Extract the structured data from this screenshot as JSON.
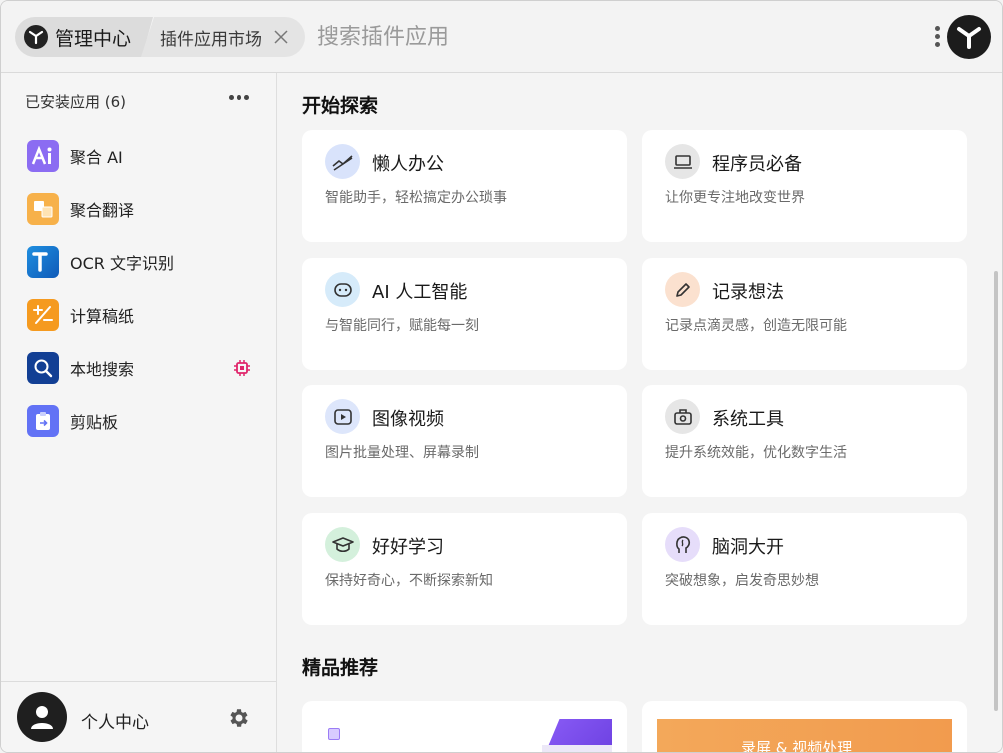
{
  "header": {
    "home_label": "管理中心",
    "market_tab_label": "插件应用市场",
    "search_placeholder": "搜索插件应用"
  },
  "sidebar": {
    "installed_header": "已安装应用 (6)",
    "items": [
      {
        "label": "聚合 AI",
        "icon": "ai-icon",
        "color": "#8b6cf2"
      },
      {
        "label": "聚合翻译",
        "icon": "translate-icon",
        "color": "#f7b14a"
      },
      {
        "label": "OCR 文字识别",
        "icon": "ocr-icon",
        "color": "#1f8fe0"
      },
      {
        "label": "计算稿纸",
        "icon": "calculator-icon",
        "color": "#f59a1f"
      },
      {
        "label": "本地搜索",
        "icon": "search-icon",
        "color": "#123f94"
      },
      {
        "label": "剪贴板",
        "icon": "clipboard-icon",
        "color": "#6272f5"
      }
    ],
    "profile_label": "个人中心"
  },
  "main": {
    "explore_title": "开始探索",
    "categories": [
      {
        "title": "懒人办公",
        "desc": "智能助手，轻松搞定办公琐事",
        "icon": "chart-trend-icon",
        "bg": "#d9e3fb"
      },
      {
        "title": "程序员必备",
        "desc": "让你更专注地改变世界",
        "icon": "laptop-icon",
        "bg": "#e6e6e6"
      },
      {
        "title": "AI 人工智能",
        "desc": "与智能同行，赋能每一刻",
        "icon": "robot-icon",
        "bg": "#d6ebfa"
      },
      {
        "title": "记录想法",
        "desc": "记录点滴灵感，创造无限可能",
        "icon": "pencil-icon",
        "bg": "#fbe1cf"
      },
      {
        "title": "图像视频",
        "desc": "图片批量处理、屏幕录制",
        "icon": "video-icon",
        "bg": "#dde6fb"
      },
      {
        "title": "系统工具",
        "desc": "提升系统效能，优化数字生活",
        "icon": "toolbox-icon",
        "bg": "#e6e6e6"
      },
      {
        "title": "好好学习",
        "desc": "保持好奇心，不断探索新知",
        "icon": "graduation-cap-icon",
        "bg": "#d4f0dc"
      },
      {
        "title": "脑洞大开",
        "desc": "突破想象，启发奇思妙想",
        "icon": "brain-icon",
        "bg": "#e6ddfa"
      }
    ],
    "featured_title": "精品推荐",
    "promo_b_text": "录屏 & 视频处理"
  }
}
